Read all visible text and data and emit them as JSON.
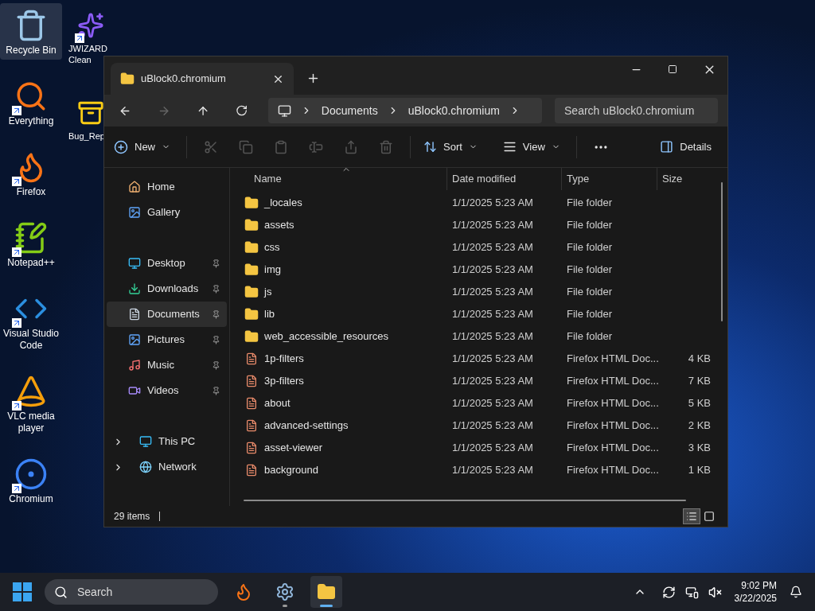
{
  "desktop_icons": [
    {
      "label": "Recycle Bin",
      "kind": "bin",
      "selected": true,
      "shortcut": false
    },
    {
      "label": "Everything",
      "kind": "search",
      "selected": false,
      "shortcut": true
    },
    {
      "label": "Firefox",
      "kind": "firefox",
      "selected": false,
      "shortcut": true
    },
    {
      "label": "Notepad++",
      "kind": "notepad",
      "selected": false,
      "shortcut": true
    },
    {
      "label": "Visual Studio Code",
      "kind": "vscode",
      "selected": false,
      "shortcut": true
    },
    {
      "label": "VLC media player",
      "kind": "vlc",
      "selected": false,
      "shortcut": true
    },
    {
      "label": "Chromium",
      "kind": "chromium",
      "selected": false,
      "shortcut": true
    }
  ],
  "desktop_icons_col2": [
    {
      "label_lines": [
        "JWIZARD",
        "Clean"
      ],
      "kind": "cleaner",
      "shortcut": true
    },
    {
      "label_lines": [
        "Bug_Rep"
      ],
      "kind": "zip",
      "shortcut": false
    }
  ],
  "window": {
    "tab_title": "uBlock0.chromium",
    "breadcrumb": [
      "Documents",
      "uBlock0.chromium"
    ],
    "search": {
      "placeholder": "Search uBlock0.chromium"
    },
    "toolbar": {
      "new": "New",
      "edit_actions": [
        {
          "disabled": true
        },
        {
          "disabled": true
        },
        {
          "disabled": true
        },
        {
          "disabled": true
        },
        {
          "disabled": true
        },
        {
          "disabled": true
        }
      ],
      "sort": "Sort",
      "view": "View",
      "details": "Details"
    },
    "sidebar_sections": [
      {
        "kind": "top",
        "items": [
          {
            "label": "Home",
            "kind": "home",
            "selected": false
          },
          {
            "label": "Gallery",
            "kind": "gallery",
            "selected": false
          }
        ]
      },
      {
        "kind": "quick",
        "items": [
          {
            "label": "Desktop",
            "kind": "desktop",
            "pinned": true,
            "selected": false
          },
          {
            "label": "Downloads",
            "kind": "downloads",
            "pinned": true,
            "selected": false
          },
          {
            "label": "Documents",
            "kind": "documents",
            "pinned": true,
            "selected": true
          },
          {
            "label": "Pictures",
            "kind": "pictures",
            "pinned": true,
            "selected": false
          },
          {
            "label": "Music",
            "kind": "music",
            "pinned": true,
            "selected": false
          },
          {
            "label": "Videos",
            "kind": "videos",
            "pinned": true,
            "selected": false
          }
        ]
      },
      {
        "kind": "tree",
        "items": [
          {
            "label": "This PC",
            "kind": "pc",
            "expanded": false,
            "selected": false
          },
          {
            "label": "Network",
            "kind": "network",
            "expanded": false,
            "selected": false
          }
        ]
      }
    ],
    "table": {
      "columns": [
        "Name",
        "Date modified",
        "Type",
        "Size"
      ],
      "rows": [
        {
          "name": "_locales",
          "date": "1/1/2025 5:23 AM",
          "type": "File folder",
          "size": "",
          "kind": "folder"
        },
        {
          "name": "assets",
          "date": "1/1/2025 5:23 AM",
          "type": "File folder",
          "size": "",
          "kind": "folder"
        },
        {
          "name": "css",
          "date": "1/1/2025 5:23 AM",
          "type": "File folder",
          "size": "",
          "kind": "folder"
        },
        {
          "name": "img",
          "date": "1/1/2025 5:23 AM",
          "type": "File folder",
          "size": "",
          "kind": "folder"
        },
        {
          "name": "js",
          "date": "1/1/2025 5:23 AM",
          "type": "File folder",
          "size": "",
          "kind": "folder"
        },
        {
          "name": "lib",
          "date": "1/1/2025 5:23 AM",
          "type": "File folder",
          "size": "",
          "kind": "folder"
        },
        {
          "name": "web_accessible_resources",
          "date": "1/1/2025 5:23 AM",
          "type": "File folder",
          "size": "",
          "kind": "folder"
        },
        {
          "name": "1p-filters",
          "date": "1/1/2025 5:23 AM",
          "type": "Firefox HTML Doc...",
          "size": "4 KB",
          "kind": "html"
        },
        {
          "name": "3p-filters",
          "date": "1/1/2025 5:23 AM",
          "type": "Firefox HTML Doc...",
          "size": "7 KB",
          "kind": "html"
        },
        {
          "name": "about",
          "date": "1/1/2025 5:23 AM",
          "type": "Firefox HTML Doc...",
          "size": "5 KB",
          "kind": "html"
        },
        {
          "name": "advanced-settings",
          "date": "1/1/2025 5:23 AM",
          "type": "Firefox HTML Doc...",
          "size": "2 KB",
          "kind": "html"
        },
        {
          "name": "asset-viewer",
          "date": "1/1/2025 5:23 AM",
          "type": "Firefox HTML Doc...",
          "size": "3 KB",
          "kind": "html"
        },
        {
          "name": "background",
          "date": "1/1/2025 5:23 AM",
          "type": "Firefox HTML Doc...",
          "size": "1 KB",
          "kind": "html"
        }
      ]
    },
    "status": "29 items",
    "view_modes": [
      {
        "kind": "details",
        "selected": true
      },
      {
        "kind": "tiles",
        "selected": false
      }
    ]
  },
  "taskbar": {
    "search_placeholder": "Search",
    "apps": [
      {
        "kind": "firefox",
        "active": false,
        "running": false
      },
      {
        "kind": "settings",
        "active": false,
        "running": true
      },
      {
        "kind": "explorer",
        "active": true,
        "running": true
      }
    ],
    "time": "9:02 PM",
    "date": "3/22/2025"
  }
}
